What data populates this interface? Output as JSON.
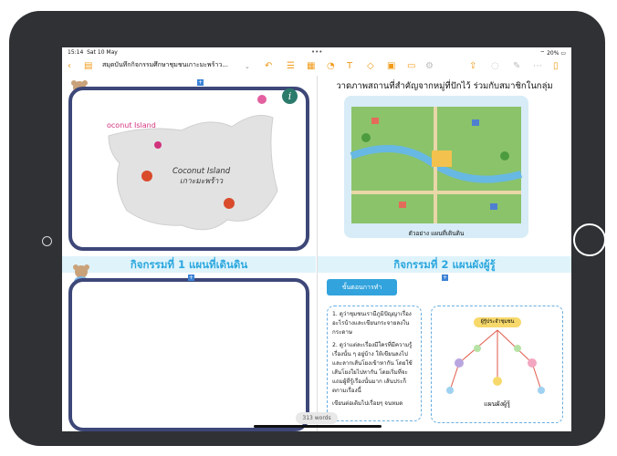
{
  "status_bar": {
    "time": "15:14",
    "date": "Sat 10 May",
    "battery": "20%"
  },
  "document": {
    "title": "สมุดบันทึกกิจกรรมศึกษาชุมชนเกาะมะพร้าว..."
  },
  "page1": {
    "map_label_partial": "oconut Island",
    "island_name_en": "Coconut Island",
    "island_name_th": "เกาะมะพร้าว"
  },
  "page2": {
    "heading": "วาดภาพสถานที่สำคัญจากหมู่ที่ปักไว้ ร่วมกับสมาชิกในกลุ่ม",
    "caption": "ตัวอย่าง แผนที่เดินดิน"
  },
  "page3": {
    "banner": "กิจกรรมที่ 1 แผนที่เดินดิน"
  },
  "page4": {
    "banner": "กิจกรรมที่ 2 แผนผังผู้รู้",
    "steps_label": "ขั้นตอนการทำ",
    "step1": "1. ดูว่าชุมชนเรามีภูมิปัญญาเรื่องอะไรบ้างและเขียนกระจายลงในกระดาษ",
    "step2": "2. ดูว่าแต่ละเรื่องมีใครที่มีความรู้เรื่องนั้น ๆ อยู่บ้าง ให้เขียนลงไปและลากเส้นโยงเข้าหากัน โดยใช้เส้นโยงใยไปหากัน โดยเริ่มที่จะแถมผู้ที่รู้เรื่องนั้นมาก เส้นประก็ตกามเรื่องนี้",
    "step2_tail": "เขียนต่อเติมไปเรื่อยๆ จนหมด",
    "mindmap_title": "ผู้รู้ประจำชุมชน",
    "mindmap_caption": "แผนผังผู้รู้"
  },
  "word_count": "313 words",
  "colors": {
    "accent": "#f19b1a",
    "frame": "#3d4778",
    "banner_text": "#2aa7de",
    "pin": "#d94b2b"
  }
}
